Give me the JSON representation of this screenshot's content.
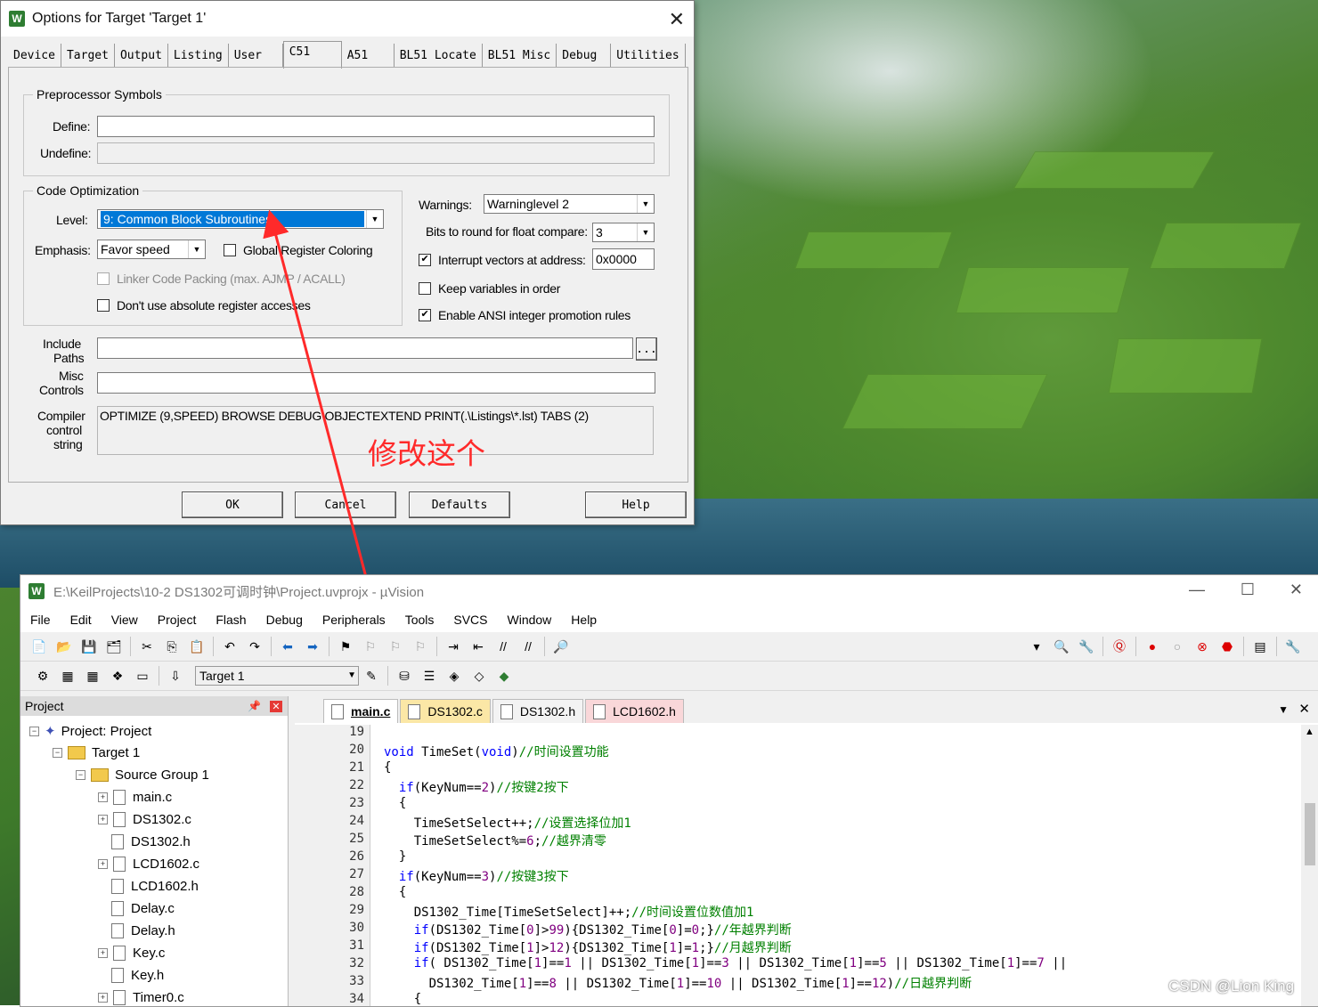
{
  "dialog": {
    "title": "Options for Target 'Target 1'",
    "icon_letter": "W",
    "close": "✕",
    "tabs": [
      "Device",
      "Target",
      "Output",
      "Listing",
      "User",
      "C51",
      "A51",
      "BL51 Locate",
      "BL51 Misc",
      "Debug",
      "Utilities"
    ],
    "active_tab": "C51",
    "preprocessor": {
      "title": "Preprocessor Symbols",
      "define_label": "Define:",
      "define_value": "",
      "undefine_label": "Undefine:",
      "undefine_value": ""
    },
    "code_opt": {
      "title": "Code Optimization",
      "level_label": "Level:",
      "level_value": "9: Common Block Subroutines",
      "emphasis_label": "Emphasis:",
      "emphasis_value": "Favor speed",
      "global_reg": "Global Register Coloring",
      "linker_packing": "Linker Code Packing (max. AJMP / ACALL)",
      "no_abs_reg": "Don't use absolute register accesses"
    },
    "right": {
      "warnings_label": "Warnings:",
      "warnings_value": "Warninglevel 2",
      "bits_label": "Bits to round for float compare:",
      "bits_value": "3",
      "interrupt_label": "Interrupt vectors at address:",
      "interrupt_value": "0x0000",
      "interrupt_checked": true,
      "keep_vars": "Keep variables in order",
      "keep_vars_checked": false,
      "ansi": "Enable ANSI integer promotion rules",
      "ansi_checked": true
    },
    "include_label_1": "Include",
    "include_label_2": "Paths",
    "include_value": "",
    "browse": "...",
    "misc_label_1": "Misc",
    "misc_label_2": "Controls",
    "misc_value": "",
    "compiler_label_1": "Compiler",
    "compiler_label_2": "control",
    "compiler_label_3": "string",
    "compiler_value": "OPTIMIZE (9,SPEED) BROWSE DEBUG OBJECTEXTEND PRINT(.\\Listings\\*.lst) TABS (2)",
    "buttons": {
      "ok": "OK",
      "cancel": "Cancel",
      "defaults": "Defaults",
      "help": "Help"
    },
    "annotation": "修改这个",
    "annotation_color": "#ff2a2a"
  },
  "ide": {
    "title": "E:\\KeilProjects\\10-2 DS1302可调时钟\\Project.uvprojx - µVision",
    "window_controls": [
      "—",
      "☐",
      "✕"
    ],
    "menu": [
      "File",
      "Edit",
      "View",
      "Project",
      "Flash",
      "Debug",
      "Peripherals",
      "Tools",
      "SVCS",
      "Window",
      "Help"
    ],
    "target_select": "Target 1",
    "project_panel": {
      "title": "Project",
      "root": "Project: Project",
      "target": "Target 1",
      "group": "Source Group 1",
      "files": [
        {
          "name": "main.c",
          "expandable": true
        },
        {
          "name": "DS1302.c",
          "expandable": true
        },
        {
          "name": "DS1302.h",
          "expandable": false
        },
        {
          "name": "LCD1602.c",
          "expandable": true
        },
        {
          "name": "LCD1602.h",
          "expandable": false
        },
        {
          "name": "Delay.c",
          "expandable": false
        },
        {
          "name": "Delay.h",
          "expandable": false
        },
        {
          "name": "Key.c",
          "expandable": true
        },
        {
          "name": "Key.h",
          "expandable": false
        },
        {
          "name": "Timer0.c",
          "expandable": true
        }
      ]
    },
    "editor_tabs": [
      "main.c",
      "DS1302.c",
      "DS1302.h",
      "LCD1602.h"
    ],
    "active_editor_tab": "main.c",
    "code_lines": [
      {
        "n": "19",
        "t": ""
      },
      {
        "n": "20",
        "t": "void TimeSet(void)//时间设置功能"
      },
      {
        "n": "21",
        "t": "{"
      },
      {
        "n": "22",
        "t": "  if(KeyNum==2)//按键2按下"
      },
      {
        "n": "23",
        "t": "  {"
      },
      {
        "n": "24",
        "t": "    TimeSetSelect++;//设置选择位加1"
      },
      {
        "n": "25",
        "t": "    TimeSetSelect%=6;//越界清零"
      },
      {
        "n": "26",
        "t": "  }"
      },
      {
        "n": "27",
        "t": "  if(KeyNum==3)//按键3按下"
      },
      {
        "n": "28",
        "t": "  {"
      },
      {
        "n": "29",
        "t": "    DS1302_Time[TimeSetSelect]++;//时间设置位数值加1"
      },
      {
        "n": "30",
        "t": "    if(DS1302_Time[0]>99){DS1302_Time[0]=0;}//年越界判断"
      },
      {
        "n": "31",
        "t": "    if(DS1302_Time[1]>12){DS1302_Time[1]=1;}//月越界判断"
      },
      {
        "n": "32",
        "t": "    if( DS1302_Time[1]==1 || DS1302_Time[1]==3 || DS1302_Time[1]==5 || DS1302_Time[1]==7 ||"
      },
      {
        "n": "33",
        "t": "      DS1302_Time[1]==8 || DS1302_Time[1]==10 || DS1302_Time[1]==12)//日越界判断"
      },
      {
        "n": "34",
        "t": "    {"
      }
    ]
  },
  "watermark": "CSDN @Lion King"
}
